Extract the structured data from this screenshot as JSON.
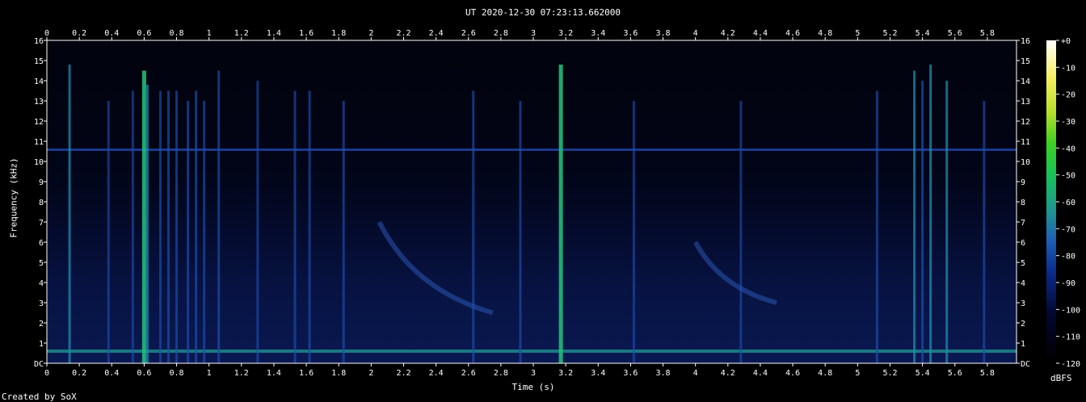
{
  "title": "UT 2020-12-30 07:23:13.662000",
  "credit": "Created by SoX",
  "chart_data": {
    "type": "heatmap",
    "xlabel": "Time (s)",
    "ylabel": "Frequency (kHz)",
    "xlim": [
      0,
      5.98
    ],
    "ylim": [
      0,
      16
    ],
    "x_ticks": [
      "0",
      "0.2",
      "0.4",
      "0.6",
      "0.8",
      "1",
      "1.2",
      "1.4",
      "1.6",
      "1.8",
      "2",
      "2.2",
      "2.4",
      "2.6",
      "2.8",
      "3",
      "3.2",
      "3.4",
      "3.6",
      "3.8",
      "4",
      "4.2",
      "4.4",
      "4.6",
      "4.8",
      "5",
      "5.2",
      "5.4",
      "5.6",
      "5.8"
    ],
    "y_ticks": [
      "DC",
      "1",
      "2",
      "3",
      "4",
      "5",
      "6",
      "7",
      "8",
      "9",
      "10",
      "11",
      "12",
      "13",
      "14",
      "15",
      "16"
    ],
    "colorbar": {
      "label": "dBFS",
      "ticks": [
        "+0",
        "-10",
        "-20",
        "-30",
        "-40",
        "-50",
        "-60",
        "-70",
        "-80",
        "-90",
        "-100",
        "-110",
        "-120"
      ],
      "range": [
        -120,
        0
      ]
    },
    "features": {
      "hum_line_khz": 0.6,
      "tone_line_khz": 10.6,
      "transients": [
        {
          "t": 0.14,
          "fmax": 14.8,
          "strength": 0.55
        },
        {
          "t": 0.6,
          "fmax": 14.5,
          "strength": 0.85
        },
        {
          "t": 0.62,
          "fmax": 13.8,
          "strength": 0.6
        },
        {
          "t": 0.38,
          "fmax": 13.0,
          "strength": 0.35
        },
        {
          "t": 0.53,
          "fmax": 13.5,
          "strength": 0.35
        },
        {
          "t": 0.7,
          "fmax": 13.5,
          "strength": 0.4
        },
        {
          "t": 0.75,
          "fmax": 13.5,
          "strength": 0.45
        },
        {
          "t": 0.8,
          "fmax": 13.5,
          "strength": 0.4
        },
        {
          "t": 0.87,
          "fmax": 13.0,
          "strength": 0.45
        },
        {
          "t": 0.92,
          "fmax": 13.5,
          "strength": 0.45
        },
        {
          "t": 0.97,
          "fmax": 13.0,
          "strength": 0.4
        },
        {
          "t": 1.06,
          "fmax": 14.5,
          "strength": 0.45
        },
        {
          "t": 1.3,
          "fmax": 14.0,
          "strength": 0.35
        },
        {
          "t": 1.53,
          "fmax": 13.5,
          "strength": 0.4
        },
        {
          "t": 1.62,
          "fmax": 13.5,
          "strength": 0.4
        },
        {
          "t": 1.83,
          "fmax": 13.0,
          "strength": 0.4
        },
        {
          "t": 2.63,
          "fmax": 13.5,
          "strength": 0.4
        },
        {
          "t": 2.92,
          "fmax": 13.0,
          "strength": 0.4
        },
        {
          "t": 3.17,
          "fmax": 14.8,
          "strength": 0.85
        },
        {
          "t": 3.62,
          "fmax": 13.0,
          "strength": 0.35
        },
        {
          "t": 4.28,
          "fmax": 13.0,
          "strength": 0.35
        },
        {
          "t": 5.12,
          "fmax": 13.5,
          "strength": 0.4
        },
        {
          "t": 5.35,
          "fmax": 14.5,
          "strength": 0.55
        },
        {
          "t": 5.4,
          "fmax": 14.0,
          "strength": 0.5
        },
        {
          "t": 5.45,
          "fmax": 14.8,
          "strength": 0.6
        },
        {
          "t": 5.55,
          "fmax": 14.0,
          "strength": 0.55
        },
        {
          "t": 5.78,
          "fmax": 13.0,
          "strength": 0.4
        }
      ],
      "sweeps": [
        {
          "t0": 2.05,
          "f0": 7.0,
          "t1": 2.75,
          "f1": 2.5
        },
        {
          "t0": 4.0,
          "f0": 6.0,
          "t1": 4.5,
          "f1": 3.0
        }
      ]
    }
  }
}
